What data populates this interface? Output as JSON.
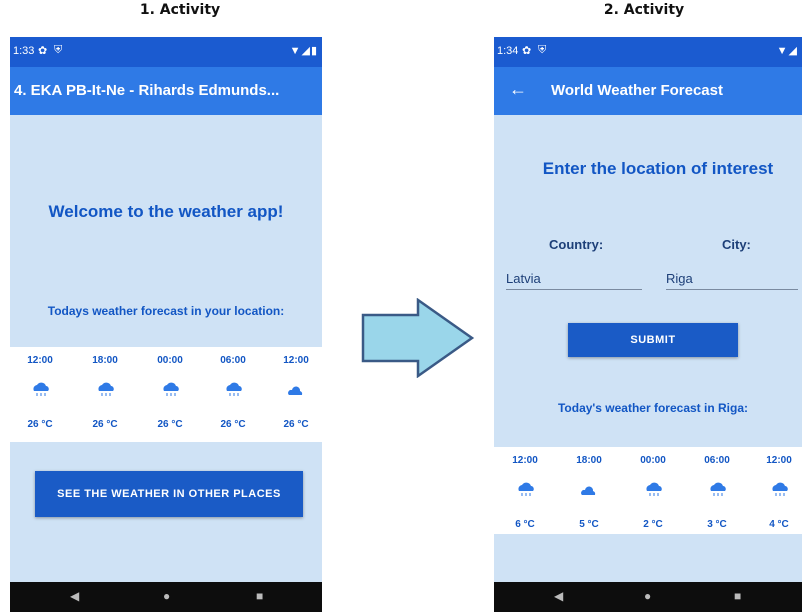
{
  "captions": [
    "1. Activity",
    "2. Activity"
  ],
  "screen1": {
    "status_time": "1:33",
    "appbar_title": "4. EKA PB-It-Ne - Rihards Edmunds...",
    "welcome": "Welcome to the weather app!",
    "subtitle": "Todays weather forecast in your location:",
    "forecast": [
      {
        "time": "12:00",
        "icon": "rain-cloud-icon",
        "temp": "26 °C"
      },
      {
        "time": "18:00",
        "icon": "rain-cloud-icon",
        "temp": "26 °C"
      },
      {
        "time": "00:00",
        "icon": "rain-cloud-icon",
        "temp": "26 °C"
      },
      {
        "time": "06:00",
        "icon": "rain-cloud-icon",
        "temp": "26 °C"
      },
      {
        "time": "12:00",
        "icon": "moon-cloud-icon",
        "temp": "26 °C"
      }
    ],
    "button": "SEE THE WEATHER IN OTHER PLACES"
  },
  "screen2": {
    "status_time": "1:34",
    "appbar_title": "World Weather Forecast",
    "heading": "Enter the location of interest",
    "country_label": "Country:",
    "city_label": "City:",
    "country_value": "Latvia",
    "city_value": "Riga",
    "submit": "SUBMIT",
    "subtitle": "Today's weather forecast in Riga:",
    "forecast": [
      {
        "time": "12:00",
        "icon": "rain-cloud-icon",
        "temp": "6 °C"
      },
      {
        "time": "18:00",
        "icon": "moon-cloud-icon",
        "temp": "5 °C"
      },
      {
        "time": "00:00",
        "icon": "rain-cloud-icon",
        "temp": "2 °C"
      },
      {
        "time": "06:00",
        "icon": "rain-cloud-icon",
        "temp": "3 °C"
      },
      {
        "time": "12:00",
        "icon": "rain-cloud-icon",
        "temp": "4 °C"
      }
    ]
  },
  "colors": {
    "statusbar": "#1b5bd0",
    "appbar": "#2f7ae6",
    "background": "#cfe2f5",
    "accent": "#1256c4",
    "arrow": "#9ad6ea"
  }
}
